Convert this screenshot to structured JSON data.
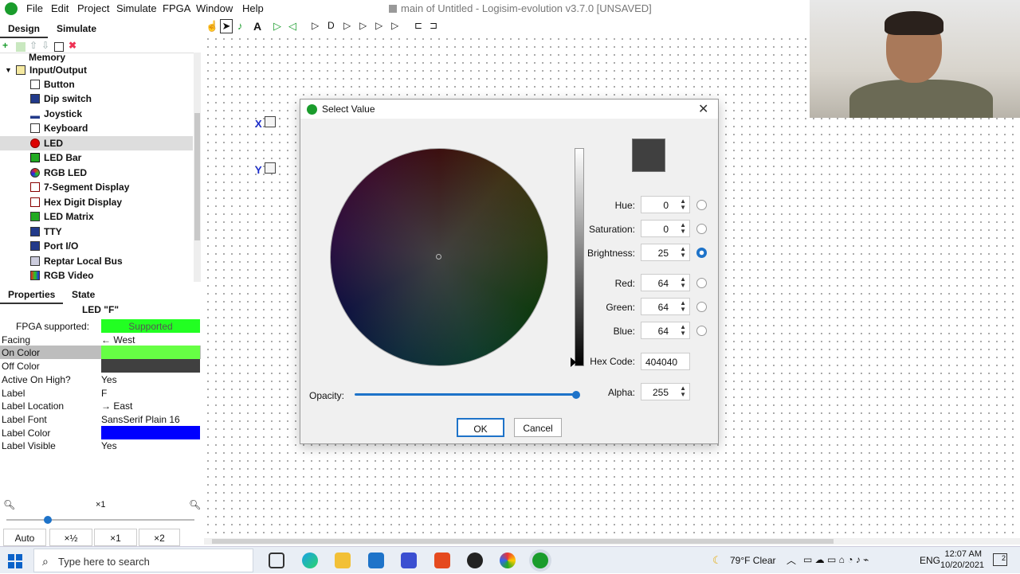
{
  "menubar": {
    "items": [
      "File",
      "Edit",
      "Project",
      "Simulate",
      "FPGA",
      "Window",
      "Help"
    ],
    "window_title": "main of Untitled - Logisim-evolution v3.7.0 [UNSAVED]"
  },
  "left_tabs": {
    "design": "Design",
    "simulate": "Simulate"
  },
  "tree": {
    "partial_item": "Memory",
    "group": "Input/Output",
    "items": [
      {
        "label": "Button",
        "icon": "button-icon"
      },
      {
        "label": "Dip switch",
        "icon": "dip-switch-icon"
      },
      {
        "label": "Joystick",
        "icon": "joystick-icon"
      },
      {
        "label": "Keyboard",
        "icon": "keyboard-icon"
      },
      {
        "label": "LED",
        "icon": "led-icon"
      },
      {
        "label": "LED Bar",
        "icon": "led-bar-icon"
      },
      {
        "label": "RGB LED",
        "icon": "rgb-led-icon"
      },
      {
        "label": "7-Segment Display",
        "icon": "seven-segment-icon"
      },
      {
        "label": "Hex Digit Display",
        "icon": "hex-digit-icon"
      },
      {
        "label": "LED Matrix",
        "icon": "led-matrix-icon"
      },
      {
        "label": "TTY",
        "icon": "tty-icon"
      },
      {
        "label": "Port I/O",
        "icon": "port-io-icon"
      },
      {
        "label": "Reptar Local Bus",
        "icon": "reptar-icon"
      },
      {
        "label": "RGB Video",
        "icon": "rgb-video-icon"
      }
    ],
    "selected": "LED"
  },
  "prop_tabs": {
    "properties": "Properties",
    "state": "State"
  },
  "properties": {
    "title": "LED \"F\"",
    "rows": [
      {
        "key": "FPGA supported:",
        "value": "Supported"
      },
      {
        "key": "Facing",
        "value": "← West"
      },
      {
        "key": "On Color",
        "value": ""
      },
      {
        "key": "Off Color",
        "value": ""
      },
      {
        "key": "Active On High?",
        "value": "Yes"
      },
      {
        "key": "Label",
        "value": "F"
      },
      {
        "key": "Label Location",
        "value": "→ East"
      },
      {
        "key": "Label Font",
        "value": "SansSerif Plain 16"
      },
      {
        "key": "Label Color",
        "value": ""
      },
      {
        "key": "Label Visible",
        "value": "Yes"
      }
    ],
    "colors": {
      "supported": "#22ff22",
      "on_color": "#66ff44",
      "off_color": "#404040",
      "label_color": "#0000ff"
    }
  },
  "zoom": {
    "level": "×1",
    "buttons": [
      "Auto",
      "×½",
      "×1",
      "×2"
    ]
  },
  "canvas": {
    "pins": [
      "X",
      "Y"
    ]
  },
  "dialog": {
    "title": "Select Value",
    "fields": {
      "hue": {
        "label": "Hue:",
        "value": "0"
      },
      "saturation": {
        "label": "Saturation:",
        "value": "0"
      },
      "brightness": {
        "label": "Brightness:",
        "value": "25"
      },
      "red": {
        "label": "Red:",
        "value": "64"
      },
      "green": {
        "label": "Green:",
        "value": "64"
      },
      "blue": {
        "label": "Blue:",
        "value": "64"
      },
      "alpha": {
        "label": "Alpha:",
        "value": "255"
      }
    },
    "hex_label": "Hex Code:",
    "hex_value": "404040",
    "opacity_label": "Opacity:",
    "opacity_fraction": 1.0,
    "selected_radio": "brightness",
    "swatch_color": "#404040",
    "ok": "OK",
    "cancel": "Cancel"
  },
  "taskbar": {
    "search_placeholder": "Type here to search",
    "weather": "79°F  Clear",
    "language": "ENG",
    "time": "12:07 AM",
    "date": "10/20/2021",
    "notification_count": "2"
  }
}
